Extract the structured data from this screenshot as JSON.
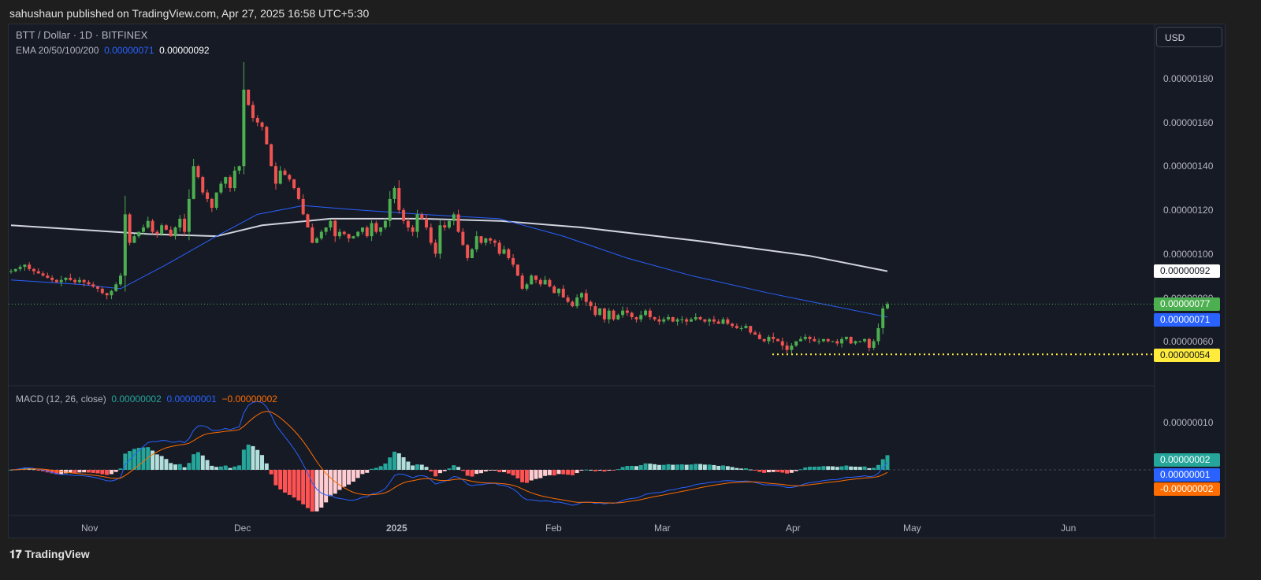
{
  "header": {
    "published": "sahushaun published on TradingView.com, Apr 27, 2025 16:58 UTC+5:30"
  },
  "legend": {
    "symbol": "BTT / Dollar · 1D · BITFINEX",
    "ema_label": "EMA 20/50/100/200",
    "ema_val1": "0.00000071",
    "ema_val2": "0.00000092",
    "macd_label": "MACD (12, 26, close)",
    "macd_val1": "0.00000002",
    "macd_val2": "0.00000001",
    "macd_val3": "−0.00000002"
  },
  "currency": "USD",
  "price_axis": [
    "0.00000180",
    "0.00000160",
    "0.00000140",
    "0.00000120",
    "0.00000100",
    "0.00000080",
    "0.00000060"
  ],
  "price_tags": {
    "ema200": "0.00000092",
    "last": "0.00000077",
    "ema50": "0.00000071",
    "support": "0.00000054"
  },
  "macd_axis": [
    "0.00000010"
  ],
  "macd_tags": {
    "hist": "0.00000002",
    "macd": "0.00000001",
    "signal": "-0.00000002"
  },
  "time_axis": [
    "Nov",
    "Dec",
    "2025",
    "Feb",
    "Mar",
    "Apr",
    "May",
    "Jun"
  ],
  "brand": "TradingView",
  "colors": {
    "up": "#4caf50",
    "down": "#f05350",
    "ema50": "#2962ff",
    "ema200": "#d1d4dc",
    "macd": "#2962ff",
    "signal": "#ff6d00",
    "support": "#ffeb3b"
  },
  "chart_data": {
    "type": "candlestick",
    "unit": "1e-8 USD",
    "start": "2024-10-17",
    "end": "2025-04-27",
    "closes": [
      92,
      93,
      94,
      95,
      93,
      92,
      91,
      90,
      89,
      88,
      87,
      88,
      89,
      88,
      87,
      88,
      87,
      86,
      85,
      84,
      82,
      81,
      83,
      86,
      90,
      118,
      105,
      108,
      110,
      112,
      115,
      110,
      109,
      113,
      111,
      108,
      112,
      116,
      110,
      125,
      140,
      135,
      128,
      125,
      121,
      128,
      132,
      135,
      130,
      138,
      140,
      175,
      168,
      162,
      160,
      158,
      150,
      140,
      132,
      138,
      136,
      134,
      130,
      125,
      118,
      112,
      105,
      107,
      110,
      112,
      115,
      108,
      110,
      109,
      107,
      108,
      110,
      112,
      108,
      114,
      110,
      112,
      115,
      125,
      130,
      120,
      115,
      112,
      110,
      118,
      116,
      112,
      105,
      100,
      113,
      112,
      115,
      118,
      110,
      104,
      98,
      102,
      108,
      105,
      107,
      106,
      105,
      100,
      102,
      98,
      95,
      90,
      84,
      86,
      90,
      88,
      86,
      88,
      85,
      82,
      84,
      80,
      78,
      76,
      80,
      82,
      78,
      76,
      72,
      75,
      70,
      74,
      70,
      72,
      74,
      73,
      71,
      70,
      72,
      74,
      71,
      70,
      69,
      70,
      71,
      69,
      70,
      70,
      69,
      70,
      71,
      70,
      69,
      70,
      69,
      68,
      70,
      68,
      67,
      66,
      66,
      67,
      64,
      63,
      61,
      60,
      62,
      61,
      60,
      58,
      56,
      58,
      60,
      61,
      62,
      61,
      60,
      60,
      61,
      60,
      60,
      59,
      61,
      62,
      59,
      60,
      60,
      61,
      57,
      60,
      66,
      75,
      77
    ],
    "ema50": [
      [
        0,
        88
      ],
      [
        15,
        86
      ],
      [
        24,
        84
      ],
      [
        34,
        95
      ],
      [
        45,
        108
      ],
      [
        54,
        118
      ],
      [
        64,
        122
      ],
      [
        76,
        120
      ],
      [
        90,
        118
      ],
      [
        107,
        116
      ],
      [
        121,
        108
      ],
      [
        135,
        98
      ],
      [
        149,
        90
      ],
      [
        166,
        82
      ],
      [
        185,
        74
      ],
      [
        192,
        71
      ]
    ],
    "ema200": [
      [
        0,
        113
      ],
      [
        30,
        109
      ],
      [
        45,
        108
      ],
      [
        55,
        113
      ],
      [
        70,
        116
      ],
      [
        90,
        116
      ],
      [
        107,
        115
      ],
      [
        125,
        112
      ],
      [
        150,
        106
      ],
      [
        175,
        99
      ],
      [
        192,
        92
      ]
    ],
    "support_level": 54,
    "ylim": [
      50,
      190
    ]
  }
}
